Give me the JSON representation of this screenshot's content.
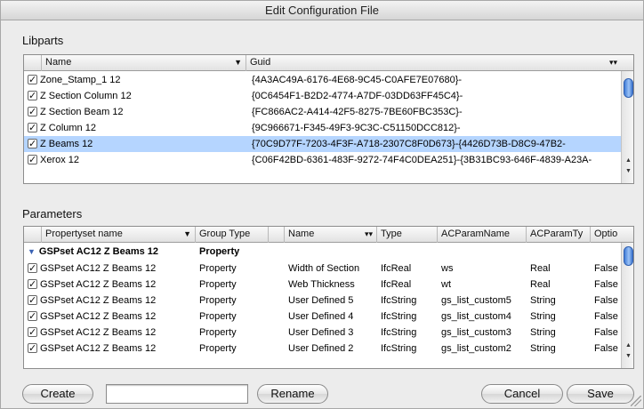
{
  "window": {
    "title": "Edit Configuration File"
  },
  "libparts": {
    "label": "Libparts",
    "columns": [
      "Name",
      "Guid"
    ],
    "rows": [
      {
        "name": "Zone_Stamp_1 12",
        "guid": "{4A3AC49A-6176-4E68-9C45-C0AFE7E07680}-"
      },
      {
        "name": "Z Section Column 12",
        "guid": "{0C6454F1-B2D2-4774-A7DF-03DD63FF45C4}-"
      },
      {
        "name": "Z Section Beam 12",
        "guid": "{FC866AC2-A414-42F5-8275-7BE60FBC353C}-"
      },
      {
        "name": "Z Column 12",
        "guid": "{9C966671-F345-49F3-9C3C-C51150DCC812}-"
      },
      {
        "name": "Z Beams 12",
        "guid": "{70C9D77F-7203-4F3F-A718-2307C8F0D673}-{4426D73B-D8C9-47B2-",
        "selected": true
      },
      {
        "name": "Xerox 12",
        "guid": "{C06F42BD-6361-483F-9272-74F4C0DEA251}-{3B31BC93-646F-4839-A23A-"
      }
    ]
  },
  "parameters": {
    "label": "Parameters",
    "columns": [
      "Propertyset name",
      "Group Type",
      "Name",
      "Type",
      "ACParamName",
      "ACParamTy",
      "Optio"
    ],
    "group": {
      "name": "GSPset AC12 Z Beams 12",
      "group_type": "Property"
    },
    "rows": [
      {
        "pset": "GSPset AC12 Z Beams 12",
        "group_type": "Property",
        "name": "Width of Section",
        "type": "IfcReal",
        "acname": "ws",
        "actype": "Real",
        "opt": "False"
      },
      {
        "pset": "GSPset AC12 Z Beams 12",
        "group_type": "Property",
        "name": "Web Thickness",
        "type": "IfcReal",
        "acname": "wt",
        "actype": "Real",
        "opt": "False"
      },
      {
        "pset": "GSPset AC12 Z Beams 12",
        "group_type": "Property",
        "name": "User Defined 5",
        "type": "IfcString",
        "acname": "gs_list_custom5",
        "actype": "String",
        "opt": "False"
      },
      {
        "pset": "GSPset AC12 Z Beams 12",
        "group_type": "Property",
        "name": "User Defined 4",
        "type": "IfcString",
        "acname": "gs_list_custom4",
        "actype": "String",
        "opt": "False"
      },
      {
        "pset": "GSPset AC12 Z Beams 12",
        "group_type": "Property",
        "name": "User Defined 3",
        "type": "IfcString",
        "acname": "gs_list_custom3",
        "actype": "String",
        "opt": "False"
      },
      {
        "pset": "GSPset AC12 Z Beams 12",
        "group_type": "Property",
        "name": "User Defined 2",
        "type": "IfcString",
        "acname": "gs_list_custom2",
        "actype": "String",
        "opt": "False"
      }
    ]
  },
  "buttons": {
    "create": "Create",
    "rename": "Rename",
    "cancel": "Cancel",
    "save": "Save"
  },
  "name_input": {
    "value": ""
  }
}
